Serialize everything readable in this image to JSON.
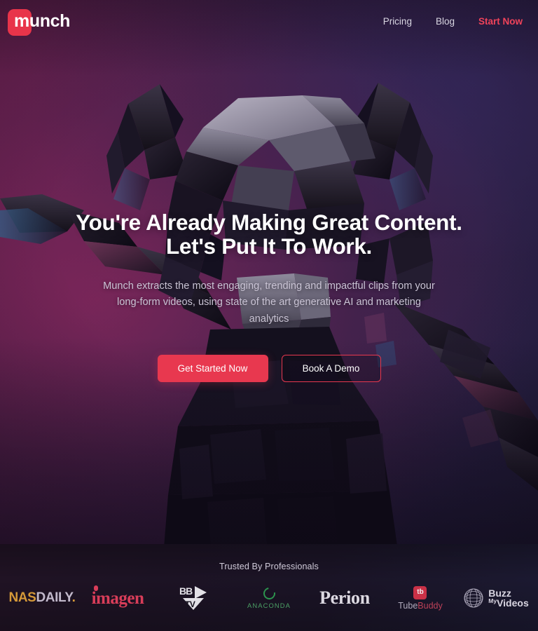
{
  "brand": {
    "name": "munch",
    "badge_color": "#e8344a"
  },
  "nav": {
    "links": [
      {
        "label": "Pricing",
        "accent": false
      },
      {
        "label": "Blog",
        "accent": false
      },
      {
        "label": "Start Now",
        "accent": true
      }
    ],
    "accent_color": "#f0435a"
  },
  "hero": {
    "headline_line1": "You're Already Making Great Content.",
    "headline_line2": "Let's Put It To Work.",
    "subhead": "Munch extracts the most engaging, trending and impactful clips from your long-form videos, using state of the art generative AI and marketing analytics",
    "primary_button": "Get Started Now",
    "secondary_button": "Book A Demo",
    "primary_color": "#e8384f"
  },
  "trusted": {
    "title": "Trusted By Professionals",
    "brands": [
      {
        "id": "nasdaily",
        "part1": "NAS",
        "part2": "DAILY",
        "part3": ".",
        "color1": "#e2a33a",
        "color2": "#cfc6d8"
      },
      {
        "id": "imagen",
        "text": "imagen",
        "color": "#e8415e"
      },
      {
        "id": "bbtv",
        "line1": "BB",
        "line2": "TV",
        "color": "#f2f0f5"
      },
      {
        "id": "anaconda",
        "text": "ANACONDA",
        "color": "#4faa6a",
        "ring_color": "#2e9e52"
      },
      {
        "id": "perion",
        "text": "Perion",
        "color": "#ebe8f0"
      },
      {
        "id": "tubebuddy",
        "badge": "tb",
        "part1": "Tube",
        "part2": "Buddy",
        "badge_color": "#d8344a",
        "color1": "#bdb7c9",
        "color2": "#c9455c"
      },
      {
        "id": "buzzmyvideos",
        "part1": "Buzz",
        "part_small": "My",
        "part2": "Videos",
        "color": "#e6e3ee"
      }
    ]
  }
}
